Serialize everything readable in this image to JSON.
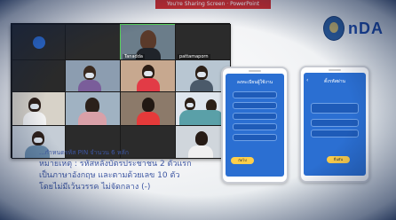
{
  "banner": {
    "text": "You're Sharing Screen · PowerPoint"
  },
  "brand": {
    "logo_text": "nDA",
    "sub_text": ""
  },
  "meeting": {
    "participants": [
      {
        "name": ""
      },
      {
        "name": ""
      },
      {
        "name": ""
      },
      {
        "name": "Tanadda"
      },
      {
        "name": ""
      },
      {
        "name": "pattamaporn"
      },
      {
        "name": ""
      },
      {
        "name": ""
      },
      {
        "name": ""
      },
      {
        "name": ""
      },
      {
        "name": ""
      },
      {
        "name": ""
      },
      {
        "name": ""
      },
      {
        "name": ""
      },
      {
        "name": ""
      },
      {
        "name": ""
      },
      {
        "name": ""
      },
      {
        "name": ""
      },
      {
        "name": ""
      }
    ]
  },
  "slide": {
    "line1": "...กำหนดรหัส PIN จำนวน 6 หลัก",
    "line2": "หมายเหตุ : รหัสหลังบัตรประชาชน 2 ตัวแรก",
    "line3": "เป็นภาษาอังกฤษ และตามด้วยเลข 10 ตัว",
    "line4": "โดยไม่มีเว้นวรรค ไม่จัดกลาง (-)"
  },
  "phone_left": {
    "title": "ลงทะเบียนผู้ใช้งาน",
    "button": "ถัดไป"
  },
  "phone_right": {
    "title": "ตั้งรหัสผ่าน",
    "button": "ยืนยัน"
  },
  "footer": {
    "text": ""
  }
}
